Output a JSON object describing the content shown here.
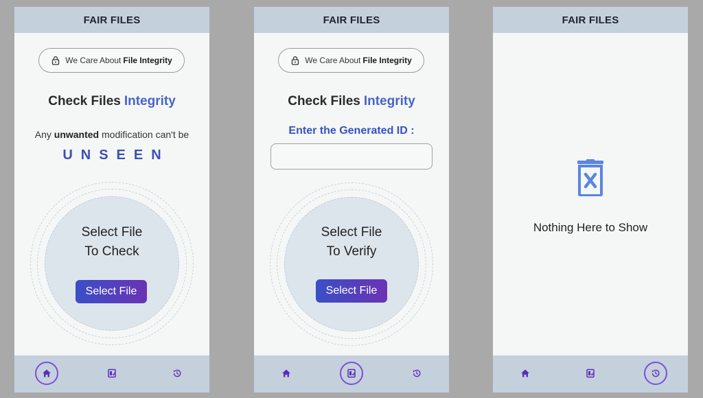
{
  "app": {
    "title": "FAIR FILES"
  },
  "badge": {
    "prefix": "We Care About",
    "bold": "File Integrity"
  },
  "heading": {
    "main": "Check Files",
    "accent": "Integrity"
  },
  "screen1": {
    "modification_prefix": "Any",
    "modification_bold": "unwanted",
    "modification_suffix": "modification can't be",
    "unseen": "UNSEEN",
    "circle_line1": "Select File",
    "circle_line2": "To  Check",
    "button": "Select File"
  },
  "screen2": {
    "enter_label": "Enter the Generated ID :",
    "id_input": {
      "value": "",
      "placeholder": ""
    },
    "circle_line1": "Select File",
    "circle_line2": "To Verify",
    "button": "Select File"
  },
  "screen3": {
    "empty_text": "Nothing Here to Show",
    "empty_icon": "trash-x-icon"
  },
  "nav": {
    "items": [
      "home-icon",
      "file-check-icon",
      "history-icon"
    ],
    "active": {
      "screen1": "home",
      "screen2": "verify",
      "screen3": "history"
    }
  },
  "colors": {
    "appbar": "#c5d0dd",
    "accent": "#4a63c8",
    "button_gradient_start": "#3a4fc7",
    "button_gradient_end": "#6a33b5",
    "active_ring": "#7a4fd6",
    "empty_icon": "#5a86e0"
  }
}
